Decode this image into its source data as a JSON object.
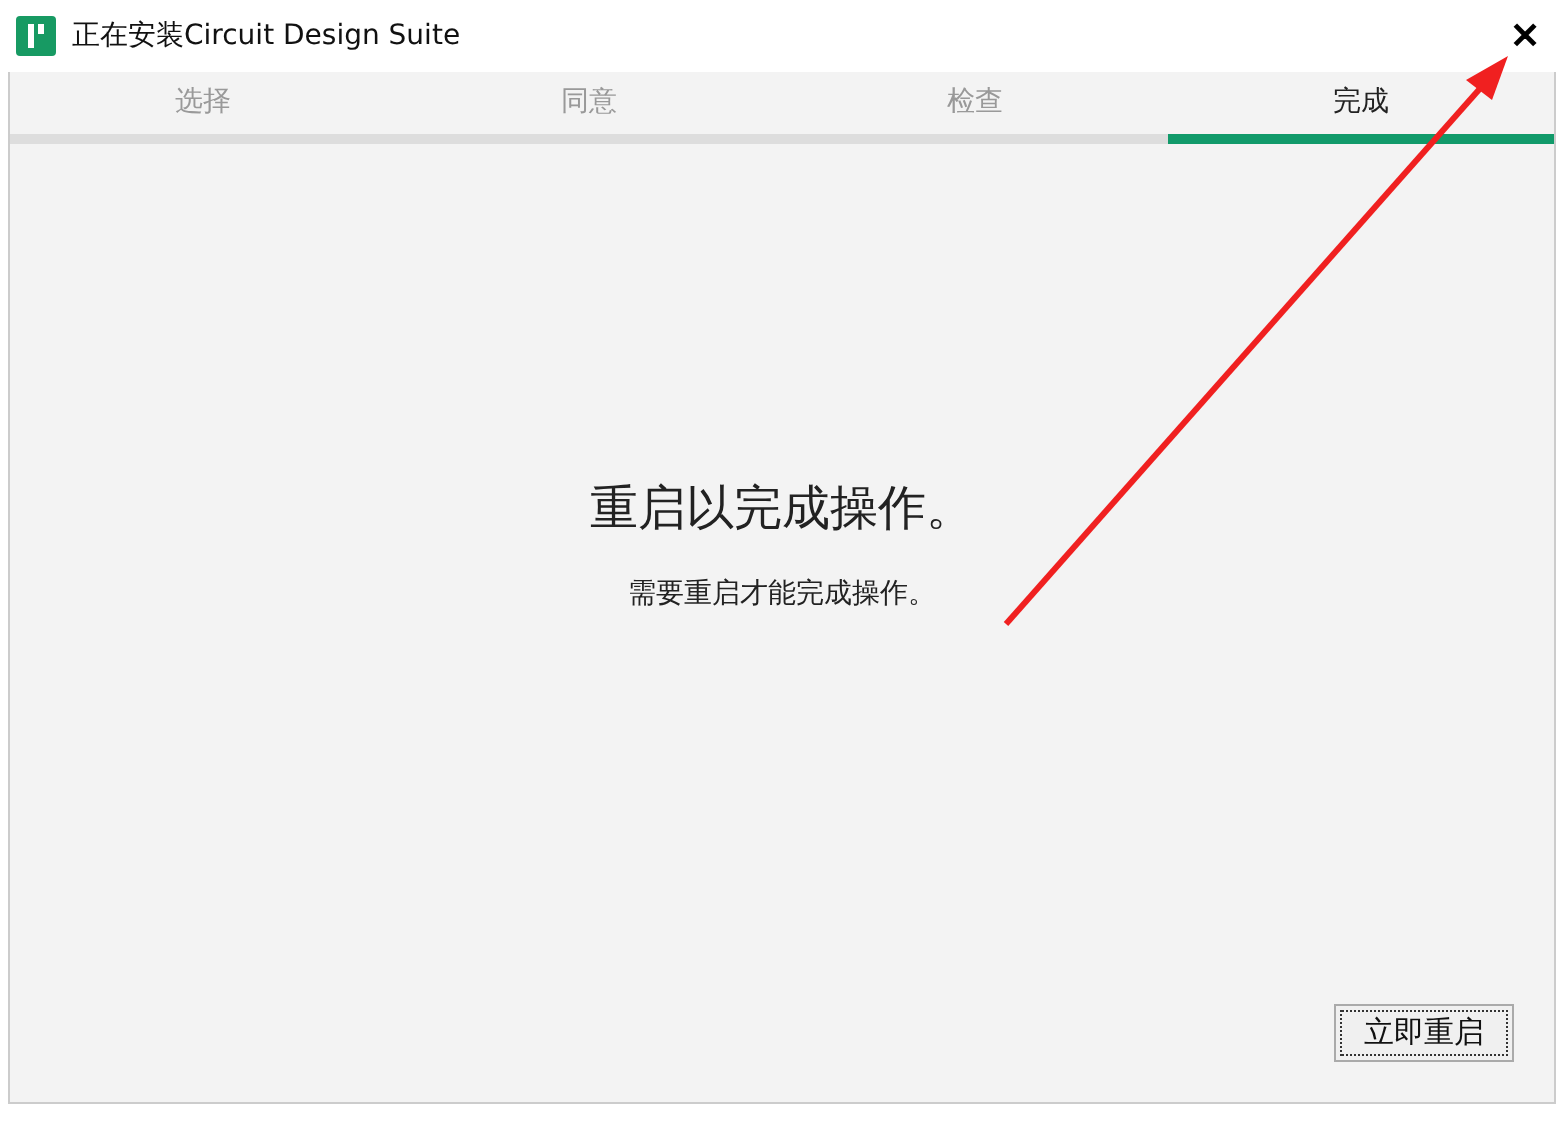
{
  "window": {
    "title": "正在安装Circuit Design Suite",
    "close": "✕"
  },
  "tabs": [
    {
      "label": "选择",
      "selected": false
    },
    {
      "label": "同意",
      "selected": false
    },
    {
      "label": "检查",
      "selected": false
    },
    {
      "label": "完成",
      "selected": true
    }
  ],
  "message": {
    "heading": "重启以完成操作。",
    "body": "需要重启才能完成操作。"
  },
  "buttons": [
    {
      "label": "立即重启",
      "focused": true
    }
  ],
  "annotation": {
    "kind": "arrow",
    "color": "#f02020"
  }
}
